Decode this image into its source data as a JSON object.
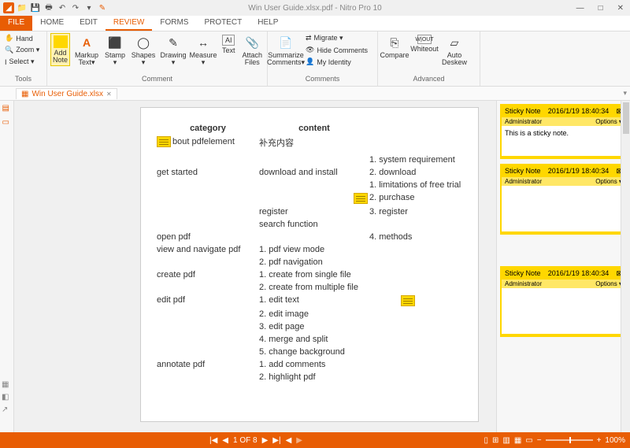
{
  "titlebar": {
    "title": "Win User Guide.xlsx.pdf - Nitro Pro 10",
    "minimize": "—",
    "maximize": "□",
    "close": "✕"
  },
  "tabs": {
    "file": "FILE",
    "items": [
      "HOME",
      "EDIT",
      "REVIEW",
      "FORMS",
      "PROTECT",
      "HELP"
    ],
    "active": 2
  },
  "ribbon": {
    "tools_group": "Tools",
    "hand": "Hand",
    "zoom": "Zoom ▾",
    "select": "Select ▾",
    "comment_group": "Comment",
    "add_note": "Add Note",
    "markup_text": "Markup Text▾",
    "stamp": "Stamp ▾",
    "shapes": "Shapes ▾",
    "drawing": "Drawing ▾",
    "measure": "Measure ▾",
    "text": "Text",
    "attach_files": "Attach Files",
    "comments_group": "Comments",
    "summarize_comments": "Summarize Comments▾",
    "migrate": "Migrate ▾",
    "hide_comments": "Hide Comments",
    "my_identity": "My Identity",
    "advanced_group": "Advanced",
    "compare": "Compare",
    "whiteout": "Whiteout",
    "auto_deskew": "Auto Deskew"
  },
  "doc": {
    "name": "Win User Guide.xlsx"
  },
  "page": {
    "h1": "category",
    "h2": "content",
    "r1c1": "bout pdfelement",
    "r1c2": "补充内容",
    "r2c1": "get started",
    "r2c2": "download and install",
    "r3c2": "register",
    "r4c2": "search function",
    "r5c1": "open pdf",
    "r6c1": "view and navigate pdf",
    "r6c2": "1. pdf view mode",
    "r7c2": "2. pdf navigation",
    "r8c1": "create pdf",
    "r8c2": "1. create from single file",
    "r9c2": "2. create from multiple file",
    "r10c1": "edit pdf",
    "r10c2": "1. edit text",
    "r11c2": "2. edit image",
    "r12c2": "3. edit page",
    "r13c2": "4. merge and split",
    "r14c2": "5. change background",
    "r15c1": "annotate pdf",
    "r15c2": "1. add comments",
    "r16c2": "2. highlight pdf",
    "c3_1": "1. system requirement",
    "c3_2": "2. download",
    "c3_3": "1. limitations of free trial",
    "c3_4": "2. purchase",
    "c3_5": "3. register",
    "c3_6": "4. methods"
  },
  "sticky": {
    "title": "Sticky Note",
    "timestamp": "2016/1/19 18:40:34",
    "author": "Administrator",
    "options": "Options ▾",
    "body1": "This is a sticky note."
  },
  "status": {
    "page_label": "1 OF 8",
    "zoom": "100%"
  }
}
